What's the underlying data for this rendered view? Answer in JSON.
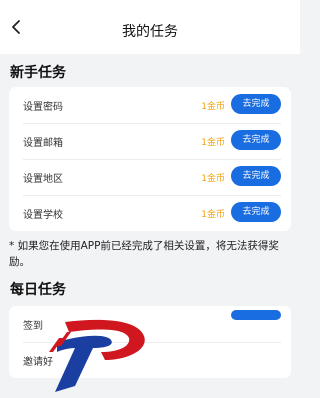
{
  "header": {
    "title": "我的任务"
  },
  "newbie": {
    "title": "新手任务",
    "items": [
      {
        "label": "设置密码",
        "reward": "1金币",
        "action": "去完成"
      },
      {
        "label": "设置邮箱",
        "reward": "1金币",
        "action": "去完成"
      },
      {
        "label": "设置地区",
        "reward": "1金币",
        "action": "去完成"
      },
      {
        "label": "设置学校",
        "reward": "1金币",
        "action": "去完成"
      }
    ]
  },
  "note": "* 如果您在使用APP前已经完成了相关设置，将无法获得奖励。",
  "daily": {
    "title": "每日任务",
    "items": [
      {
        "label": "签到"
      },
      {
        "label": "邀请好"
      }
    ]
  },
  "colors": {
    "accent": "#1a6de0",
    "reward": "#f2a20c",
    "background": "#f2f3f5"
  }
}
